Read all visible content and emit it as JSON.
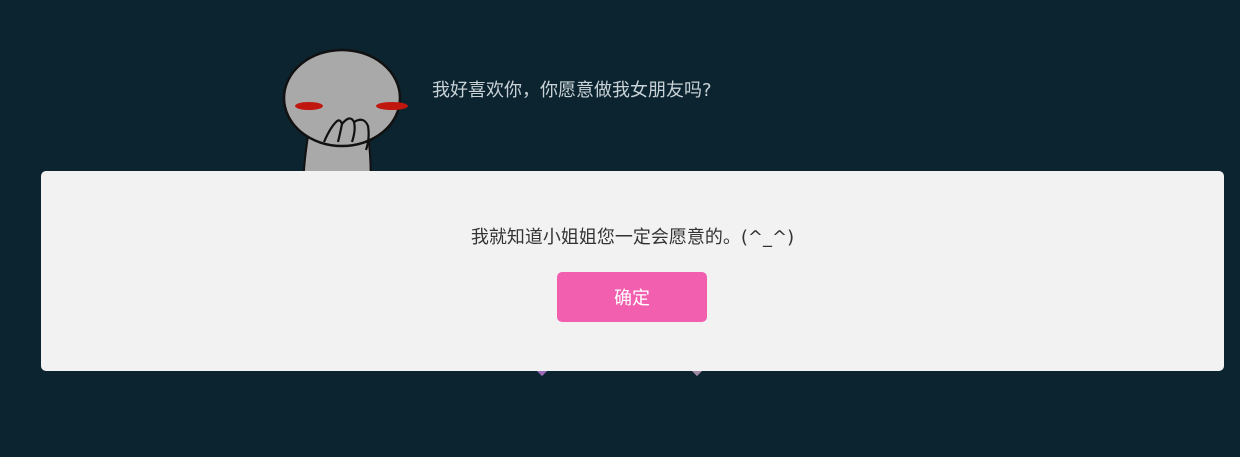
{
  "page": {
    "question": "我好喜欢你，你愿意做我女朋友吗?",
    "character_icon": "shy-character-icon"
  },
  "dialog": {
    "message": "我就知道小姐姐您一定会愿意的。(^_^)",
    "confirm_label": "确定"
  },
  "colors": {
    "background": "#0b2430",
    "dialog_background": "#f2f2f2",
    "button": "#f25faf",
    "button_text": "#ffffff",
    "question_text": "#c9d2d6",
    "message_text": "#333333"
  }
}
